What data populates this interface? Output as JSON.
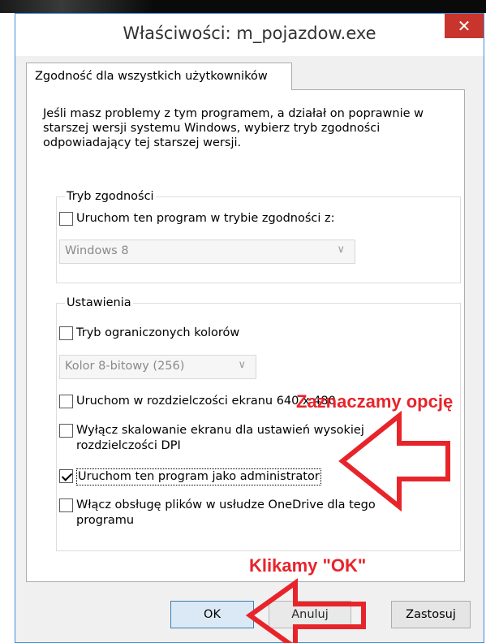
{
  "window": {
    "title": "Właściwości: m_pojazdow.exe",
    "close_glyph": "✕"
  },
  "tabs": [
    {
      "label": "Zgodność dla wszystkich użytkowników"
    }
  ],
  "intro_text": "Jeśli masz problemy z tym programem, a działał on poprawnie w starszej wersji systemu Windows, wybierz tryb zgodności odpowiadający tej starszej wersji.",
  "compat_group": {
    "legend": "Tryb zgodności",
    "checkbox_label": "Uruchom ten program w trybie zgodności z:",
    "checked": false,
    "dropdown_value": "Windows 8"
  },
  "settings_group": {
    "legend": "Ustawienia",
    "reduced_colors": {
      "label": "Tryb ograniczonych kolorów",
      "checked": false
    },
    "color_dropdown_value": "Kolor 8-bitowy (256)",
    "resolution": {
      "label": "Uruchom w rozdzielczości ekranu 640 x 480",
      "checked": false
    },
    "dpi": {
      "label_line1": "Wyłącz skalowanie ekranu dla ustawień wysokiej",
      "label_line2": "rozdzielczości DPI",
      "checked": false
    },
    "admin": {
      "label": "Uruchom ten program jako administrator",
      "checked": true
    },
    "onedrive": {
      "label_line1": "Włącz obsługę plików w usłudze OneDrive dla tego",
      "label_line2": "programu",
      "checked": false
    }
  },
  "buttons": {
    "ok": "OK",
    "cancel": "Anuluj",
    "apply": "Zastosuj"
  },
  "annotations": {
    "select_option": "Zaznaczamy opcję",
    "click_ok": "Klikamy \"OK\"",
    "color": "#e8242b"
  }
}
